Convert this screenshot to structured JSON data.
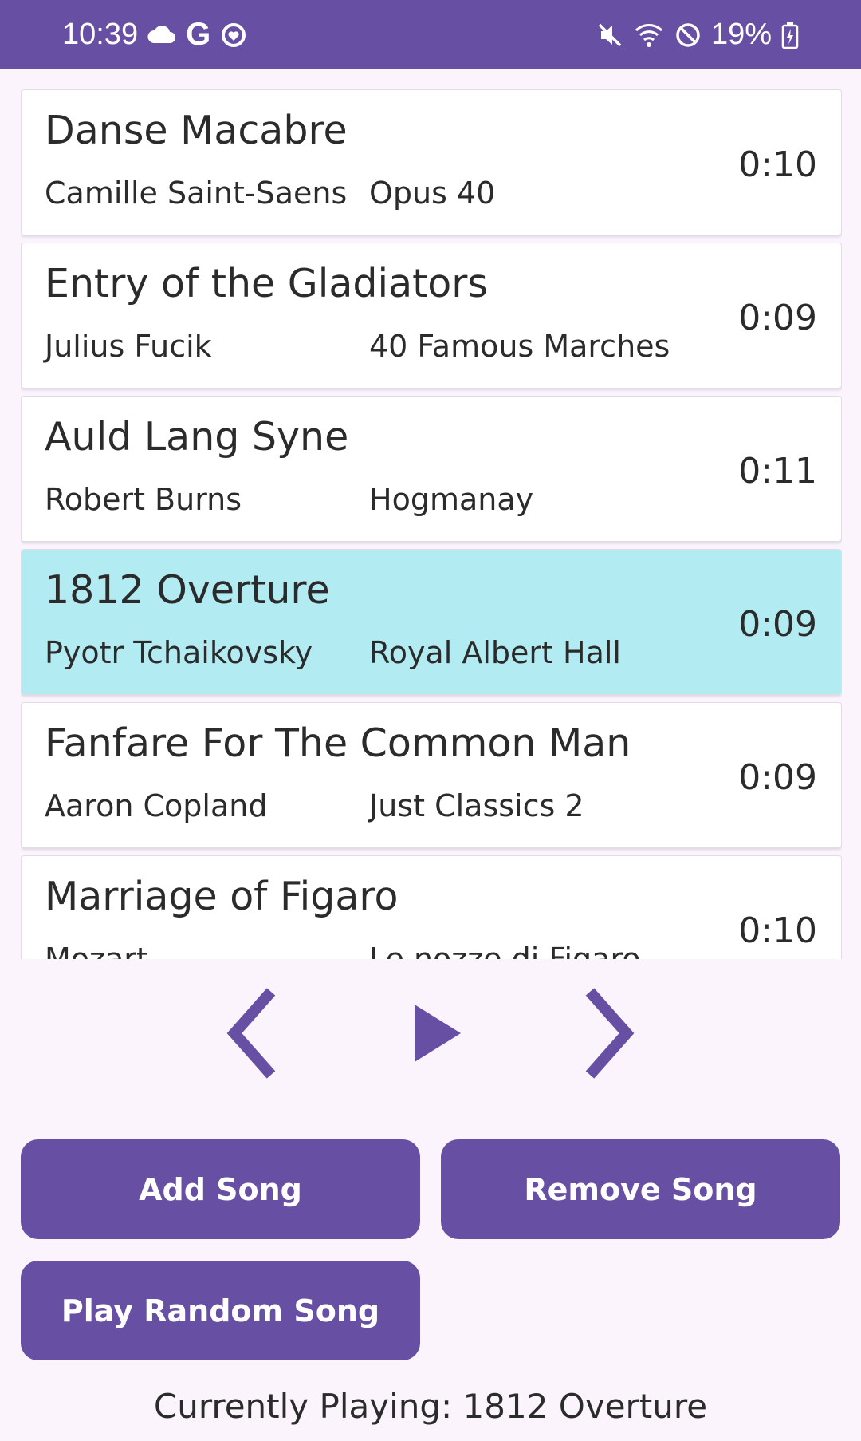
{
  "status_bar": {
    "time": "10:39",
    "battery": "19%",
    "left_icons": [
      "cloud-icon",
      "google-icon",
      "app-notification-icon"
    ],
    "right_icons": [
      "mute-icon",
      "wifi-icon",
      "do-not-disturb-icon",
      "battery-charging-icon"
    ]
  },
  "songs": [
    {
      "title": "Danse Macabre",
      "artist": "Camille Saint-Saens",
      "album": "Opus 40",
      "duration": "0:10",
      "selected": false
    },
    {
      "title": "Entry of the Gladiators",
      "artist": "Julius Fucik",
      "album": "40 Famous Marches",
      "duration": "0:09",
      "selected": false
    },
    {
      "title": "Auld Lang Syne",
      "artist": "Robert Burns",
      "album": "Hogmanay",
      "duration": "0:11",
      "selected": false
    },
    {
      "title": "1812 Overture",
      "artist": "Pyotr Tchaikovsky",
      "album": "Royal Albert Hall",
      "duration": "0:09",
      "selected": true
    },
    {
      "title": "Fanfare For The Common Man",
      "artist": "Aaron Copland",
      "album": "Just Classics 2",
      "duration": "0:09",
      "selected": false
    },
    {
      "title": "Marriage of Figaro",
      "artist": "Mozart",
      "album": "Le nozze di Figaro",
      "duration": "0:10",
      "selected": false
    }
  ],
  "controls": {
    "prev_icon": "chevron-left-icon",
    "play_icon": "play-icon",
    "next_icon": "chevron-right-icon"
  },
  "buttons": {
    "add_song": "Add Song",
    "remove_song": "Remove Song",
    "play_random": "Play Random Song"
  },
  "now_playing": "Currently Playing: 1812 Overture",
  "colors": {
    "primary": "#6750A4",
    "selected_row": "#B2EBF2",
    "background": "#FBF4FD"
  }
}
